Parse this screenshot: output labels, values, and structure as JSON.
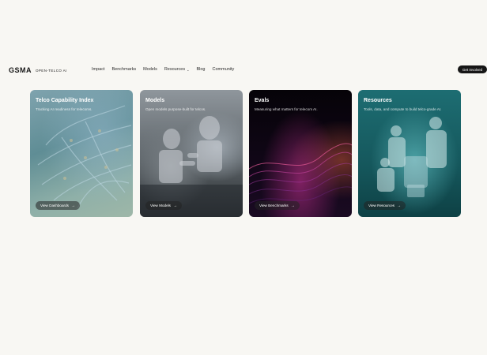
{
  "brand": {
    "logo": "GSMA",
    "subtitle": "OPEN-TELCO AI"
  },
  "nav": {
    "links": [
      "Impact",
      "Benchmarks",
      "Models",
      "Resources",
      "Blog",
      "Community"
    ],
    "cta": "Get Involved"
  },
  "cards": [
    {
      "title": "Telco Capability Index",
      "description": "Tracking AI readiness for telecoms.",
      "button": "View Dashboards"
    },
    {
      "title": "Models",
      "description": "Open models purpose-built for telcos.",
      "button": "View Models"
    },
    {
      "title": "Evals",
      "description": "Measuring what matters for telecom AI.",
      "button": "View Benchmarks"
    },
    {
      "title": "Resources",
      "description": "Tools, data, and compute to build telco-grade AI.",
      "button": "View Resources"
    }
  ],
  "colors": {
    "background": "#f8f7f3",
    "cta": "#161616"
  }
}
